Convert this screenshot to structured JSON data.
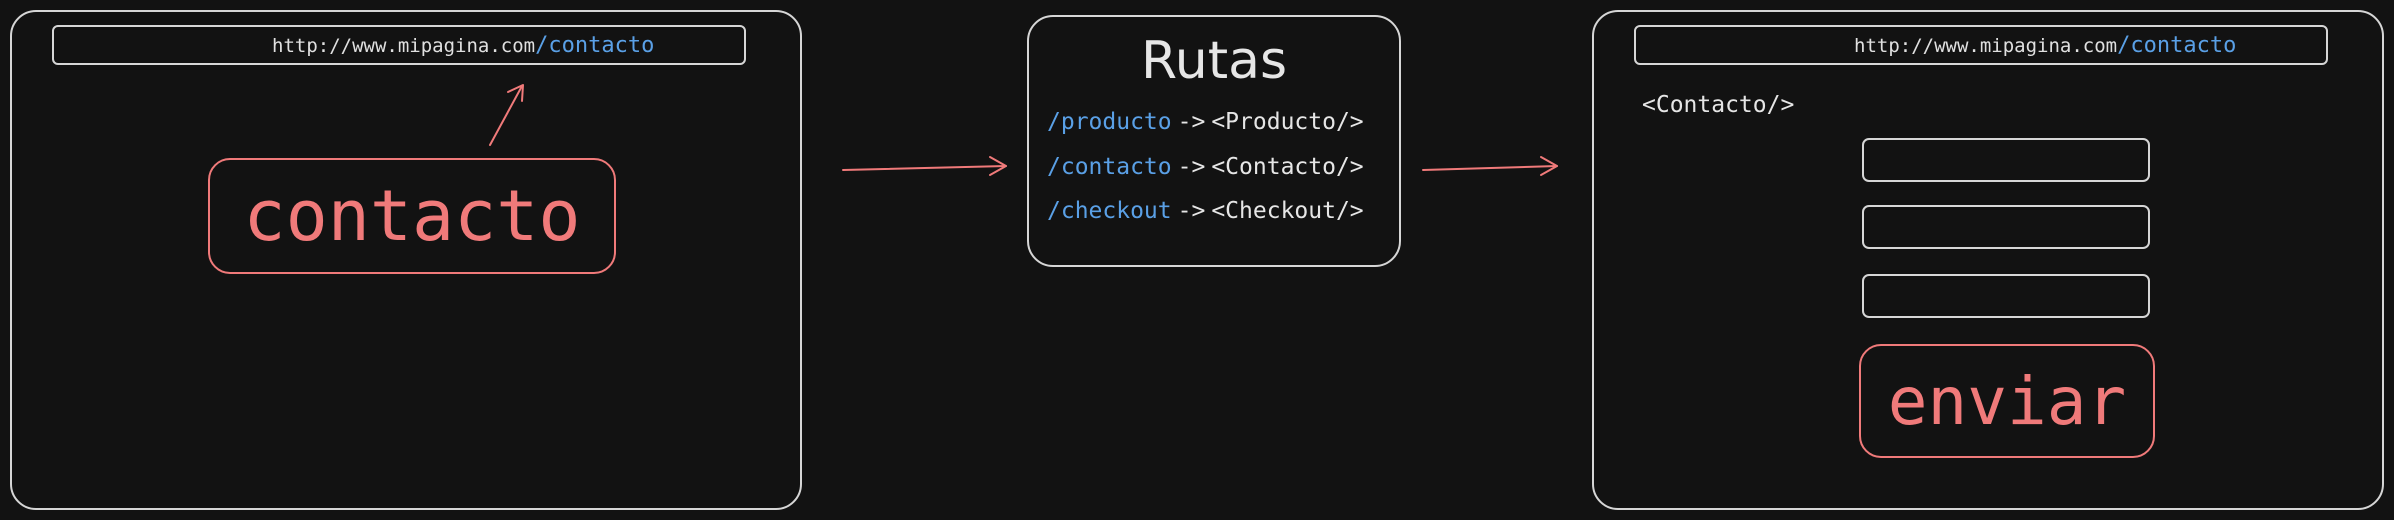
{
  "left_browser": {
    "url_host": "http://www.mipagina.com",
    "url_path": "/contacto",
    "link_label": "contacto"
  },
  "routes": {
    "title": "Rutas",
    "items": [
      {
        "path": "/producto",
        "arrow": "->",
        "component": "<Producto/>"
      },
      {
        "path": "/contacto",
        "arrow": "->",
        "component": "<Contacto/>"
      },
      {
        "path": "/checkout",
        "arrow": "->",
        "component": "<Checkout/>"
      }
    ]
  },
  "right_browser": {
    "url_host": "http://www.mipagina.com",
    "url_path": "/contacto",
    "component_label": "<Contacto/>",
    "submit_label": "enviar"
  },
  "colors": {
    "background": "#121212",
    "outline": "#d6d6d6",
    "accent_red": "#f07a7a",
    "path_blue": "#5aa0e6"
  }
}
